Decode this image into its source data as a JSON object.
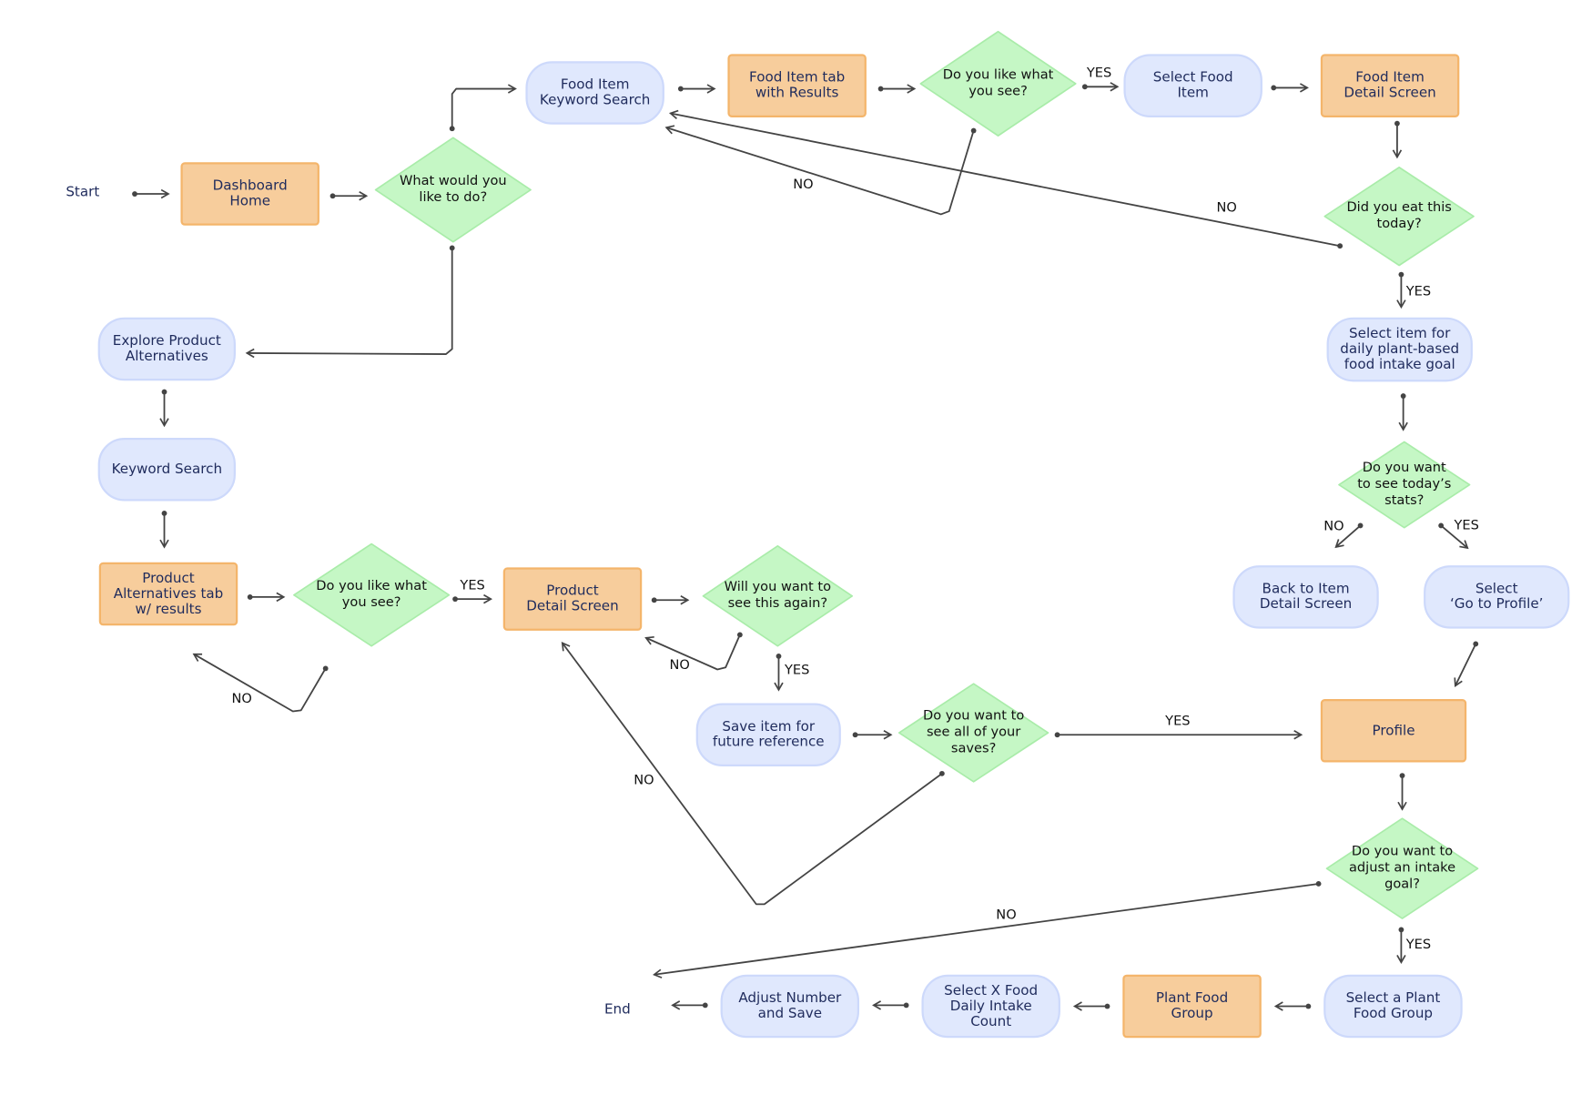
{
  "colors": {
    "process_fill": "#f7cd9c",
    "process_border": "#f4b56b",
    "pill_fill": "#e0e8fd",
    "pill_border": "#cdd9fb",
    "decision_fill": "#c5f7c5",
    "decision_border": "#a9eca9",
    "terminal_border": "#8a8a8a",
    "connector": "#444444",
    "text": "#1f2b5c"
  },
  "nodes": [
    {
      "id": "start",
      "type": "terminal",
      "label": "Start"
    },
    {
      "id": "dashboard",
      "type": "process",
      "label": "Dashboard\nHome"
    },
    {
      "id": "what_to_do",
      "type": "decision",
      "label": "What would you\nlike to do?"
    },
    {
      "id": "fi_keyword",
      "type": "pill",
      "label": "Food Item\nKeyword Search"
    },
    {
      "id": "fi_tab",
      "type": "process",
      "label": "Food Item tab\nwith Results"
    },
    {
      "id": "like_fi",
      "type": "decision",
      "label": "Do you like what\nyou see?"
    },
    {
      "id": "select_food",
      "type": "pill",
      "label": "Select Food\nItem"
    },
    {
      "id": "fi_detail",
      "type": "process",
      "label": "Food Item\nDetail Screen"
    },
    {
      "id": "eat_today",
      "type": "decision",
      "label": "Did you eat this\ntoday?"
    },
    {
      "id": "select_goal",
      "type": "pill",
      "label": "Select item for\ndaily plant-based\nfood intake goal"
    },
    {
      "id": "see_stats",
      "type": "decision",
      "label": "Do you want\nto see today’s\nstats?"
    },
    {
      "id": "back_detail",
      "type": "pill",
      "label": "Back to Item\nDetail Screen"
    },
    {
      "id": "go_profile",
      "type": "pill",
      "label": "Select\n‘Go to Profile’"
    },
    {
      "id": "profile",
      "type": "process",
      "label": "Profile"
    },
    {
      "id": "adjust_goal",
      "type": "decision",
      "label": "Do you want to\nadjust an intake\ngoal?"
    },
    {
      "id": "select_plant",
      "type": "pill",
      "label": "Select a Plant\nFood Group"
    },
    {
      "id": "plant_group",
      "type": "process",
      "label": "Plant Food\nGroup"
    },
    {
      "id": "select_x",
      "type": "pill",
      "label": "Select X Food\nDaily Intake\nCount"
    },
    {
      "id": "adjust_save",
      "type": "pill",
      "label": "Adjust Number\nand Save"
    },
    {
      "id": "end",
      "type": "terminal",
      "label": "End"
    },
    {
      "id": "explore",
      "type": "pill",
      "label": "Explore Product\nAlternatives"
    },
    {
      "id": "keyword",
      "type": "pill",
      "label": "Keyword Search"
    },
    {
      "id": "prod_alt_tab",
      "type": "process",
      "label": "Product\nAlternatives tab\nw/ results"
    },
    {
      "id": "like_prod",
      "type": "decision",
      "label": "Do you like what\nyou see?"
    },
    {
      "id": "prod_detail",
      "type": "process",
      "label": "Product\nDetail Screen"
    },
    {
      "id": "see_again",
      "type": "decision",
      "label": "Will you want to\nsee this again?"
    },
    {
      "id": "save_item",
      "type": "pill",
      "label": "Save item for\nfuture reference"
    },
    {
      "id": "see_saves",
      "type": "decision",
      "label": "Do you want to\nsee all of your\nsaves?"
    }
  ],
  "edges": [
    {
      "from": "start",
      "to": "dashboard",
      "label": ""
    },
    {
      "from": "dashboard",
      "to": "what_to_do",
      "label": ""
    },
    {
      "from": "what_to_do",
      "to": "fi_keyword",
      "label": ""
    },
    {
      "from": "fi_keyword",
      "to": "fi_tab",
      "label": ""
    },
    {
      "from": "fi_tab",
      "to": "like_fi",
      "label": ""
    },
    {
      "from": "like_fi",
      "to": "select_food",
      "label": "YES"
    },
    {
      "from": "select_food",
      "to": "fi_detail",
      "label": ""
    },
    {
      "from": "fi_detail",
      "to": "eat_today",
      "label": ""
    },
    {
      "from": "eat_today",
      "to": "fi_keyword",
      "label": "NO"
    },
    {
      "from": "like_fi",
      "to": "fi_keyword",
      "label": "NO"
    },
    {
      "from": "eat_today",
      "to": "select_goal",
      "label": "YES"
    },
    {
      "from": "select_goal",
      "to": "see_stats",
      "label": ""
    },
    {
      "from": "see_stats",
      "to": "back_detail",
      "label": "NO"
    },
    {
      "from": "see_stats",
      "to": "go_profile",
      "label": "YES"
    },
    {
      "from": "go_profile",
      "to": "profile",
      "label": ""
    },
    {
      "from": "profile",
      "to": "adjust_goal",
      "label": ""
    },
    {
      "from": "adjust_goal",
      "to": "select_plant",
      "label": "YES"
    },
    {
      "from": "adjust_goal",
      "to": "end",
      "label": "NO"
    },
    {
      "from": "select_plant",
      "to": "plant_group",
      "label": ""
    },
    {
      "from": "plant_group",
      "to": "select_x",
      "label": ""
    },
    {
      "from": "select_x",
      "to": "adjust_save",
      "label": ""
    },
    {
      "from": "adjust_save",
      "to": "end",
      "label": ""
    },
    {
      "from": "what_to_do",
      "to": "explore",
      "label": ""
    },
    {
      "from": "explore",
      "to": "keyword",
      "label": ""
    },
    {
      "from": "keyword",
      "to": "prod_alt_tab",
      "label": ""
    },
    {
      "from": "prod_alt_tab",
      "to": "like_prod",
      "label": ""
    },
    {
      "from": "like_prod",
      "to": "prod_detail",
      "label": "YES"
    },
    {
      "from": "prod_detail",
      "to": "see_again",
      "label": ""
    },
    {
      "from": "like_prod",
      "to": "prod_alt_tab",
      "label": "NO"
    },
    {
      "from": "see_again",
      "to": "prod_detail",
      "label": "NO"
    },
    {
      "from": "see_again",
      "to": "save_item",
      "label": "YES"
    },
    {
      "from": "save_item",
      "to": "see_saves",
      "label": ""
    },
    {
      "from": "see_saves",
      "to": "profile",
      "label": "YES"
    },
    {
      "from": "see_saves",
      "to": "prod_detail",
      "label": "NO"
    }
  ]
}
